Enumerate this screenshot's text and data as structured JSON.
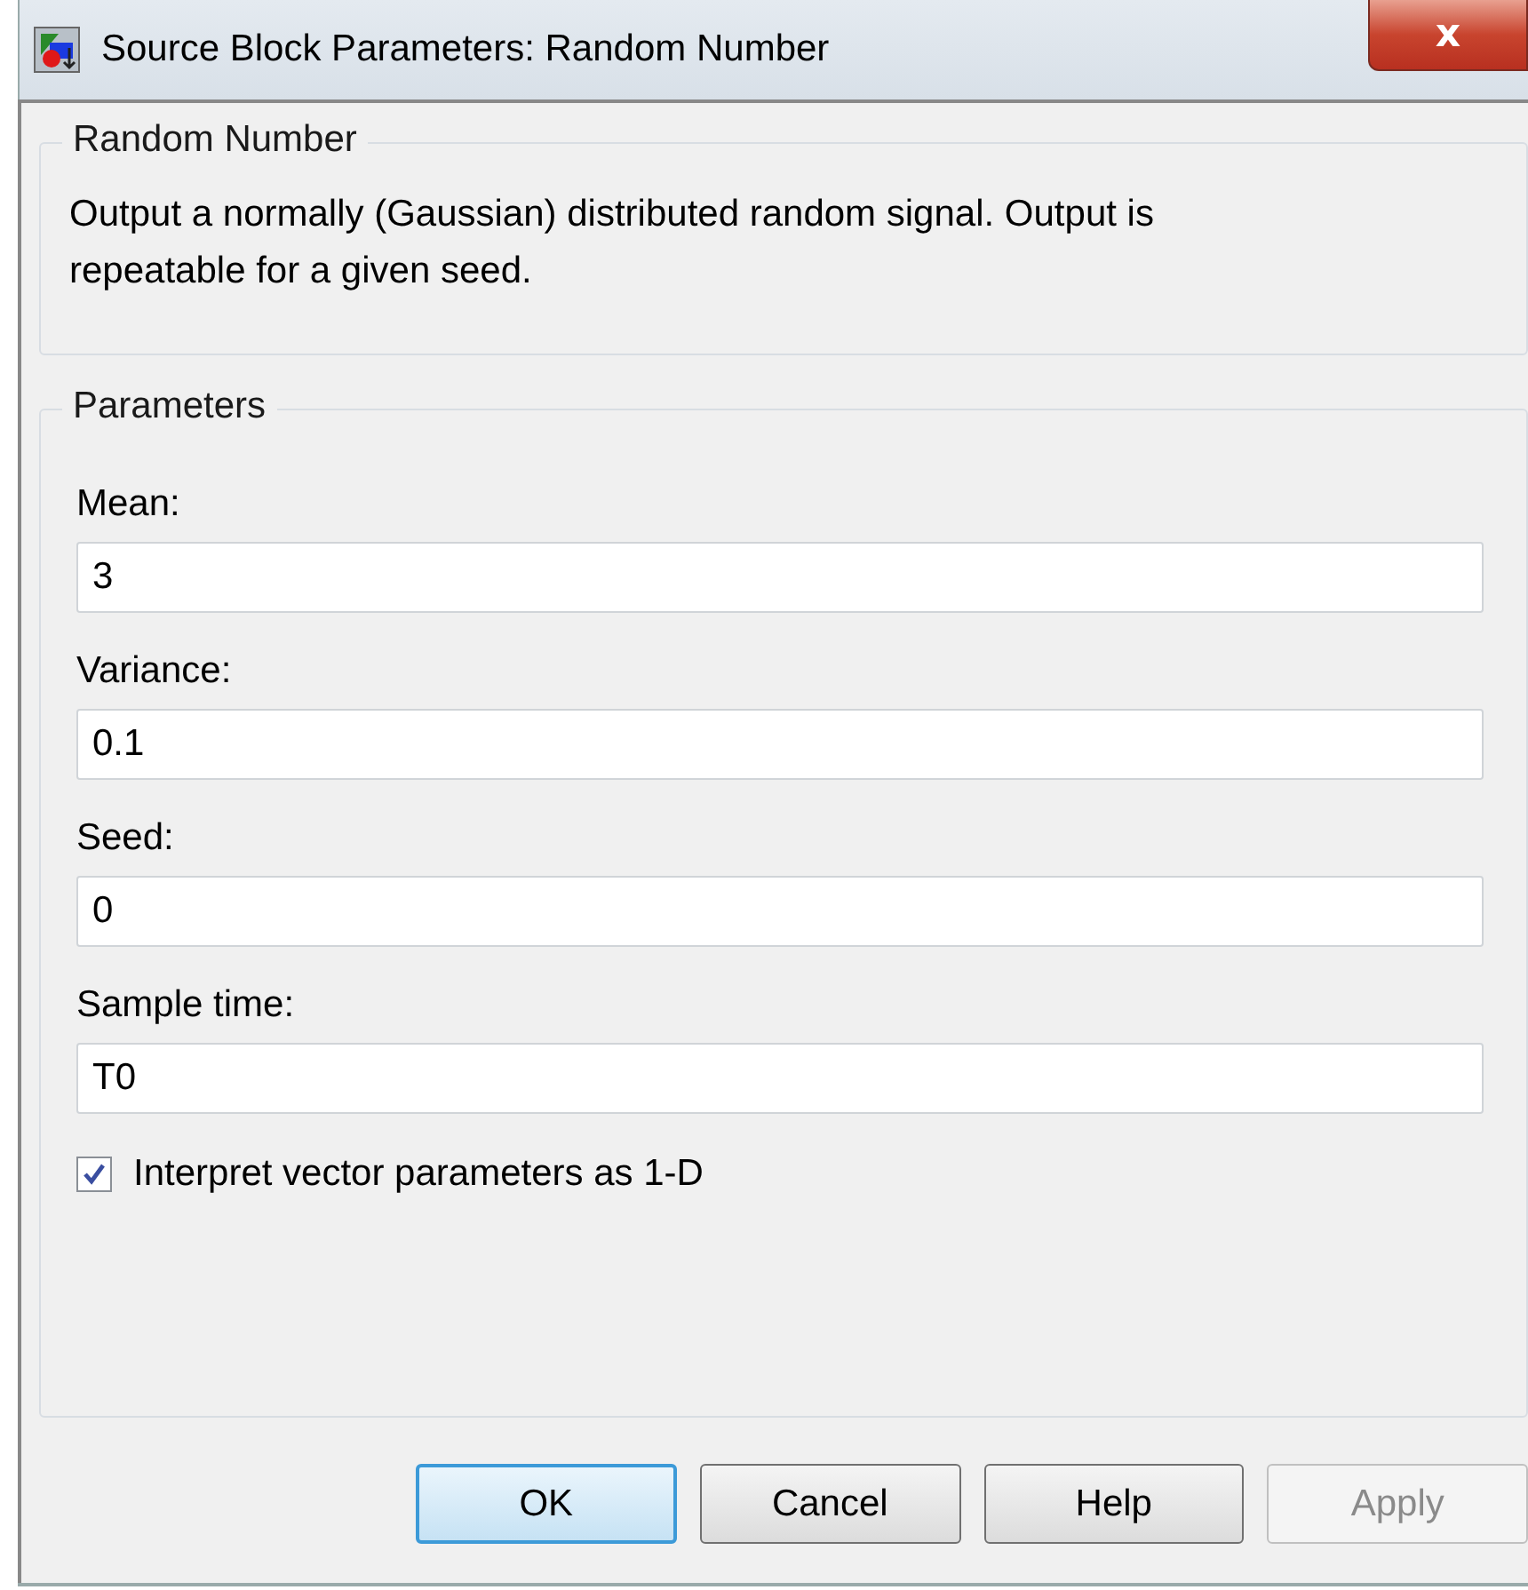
{
  "window": {
    "title": "Source Block Parameters: Random Number",
    "close": "x"
  },
  "description_group": {
    "title": "Random Number",
    "text": "Output a normally (Gaussian) distributed random signal.  Output is repeatable for a given seed."
  },
  "parameters_group": {
    "title": "Parameters",
    "fields": [
      {
        "label": "Mean:",
        "value": "3"
      },
      {
        "label": "Variance:",
        "value": "0.1"
      },
      {
        "label": "Seed:",
        "value": "0"
      },
      {
        "label": "Sample time:",
        "value": "T0"
      }
    ],
    "checkbox": {
      "label": "Interpret vector parameters as 1-D",
      "checked": true
    }
  },
  "buttons": [
    {
      "label": "OK",
      "default": true,
      "disabled": false
    },
    {
      "label": "Cancel",
      "default": false,
      "disabled": false
    },
    {
      "label": "Help",
      "default": false,
      "disabled": false
    },
    {
      "label": "Apply",
      "default": false,
      "disabled": true
    }
  ]
}
